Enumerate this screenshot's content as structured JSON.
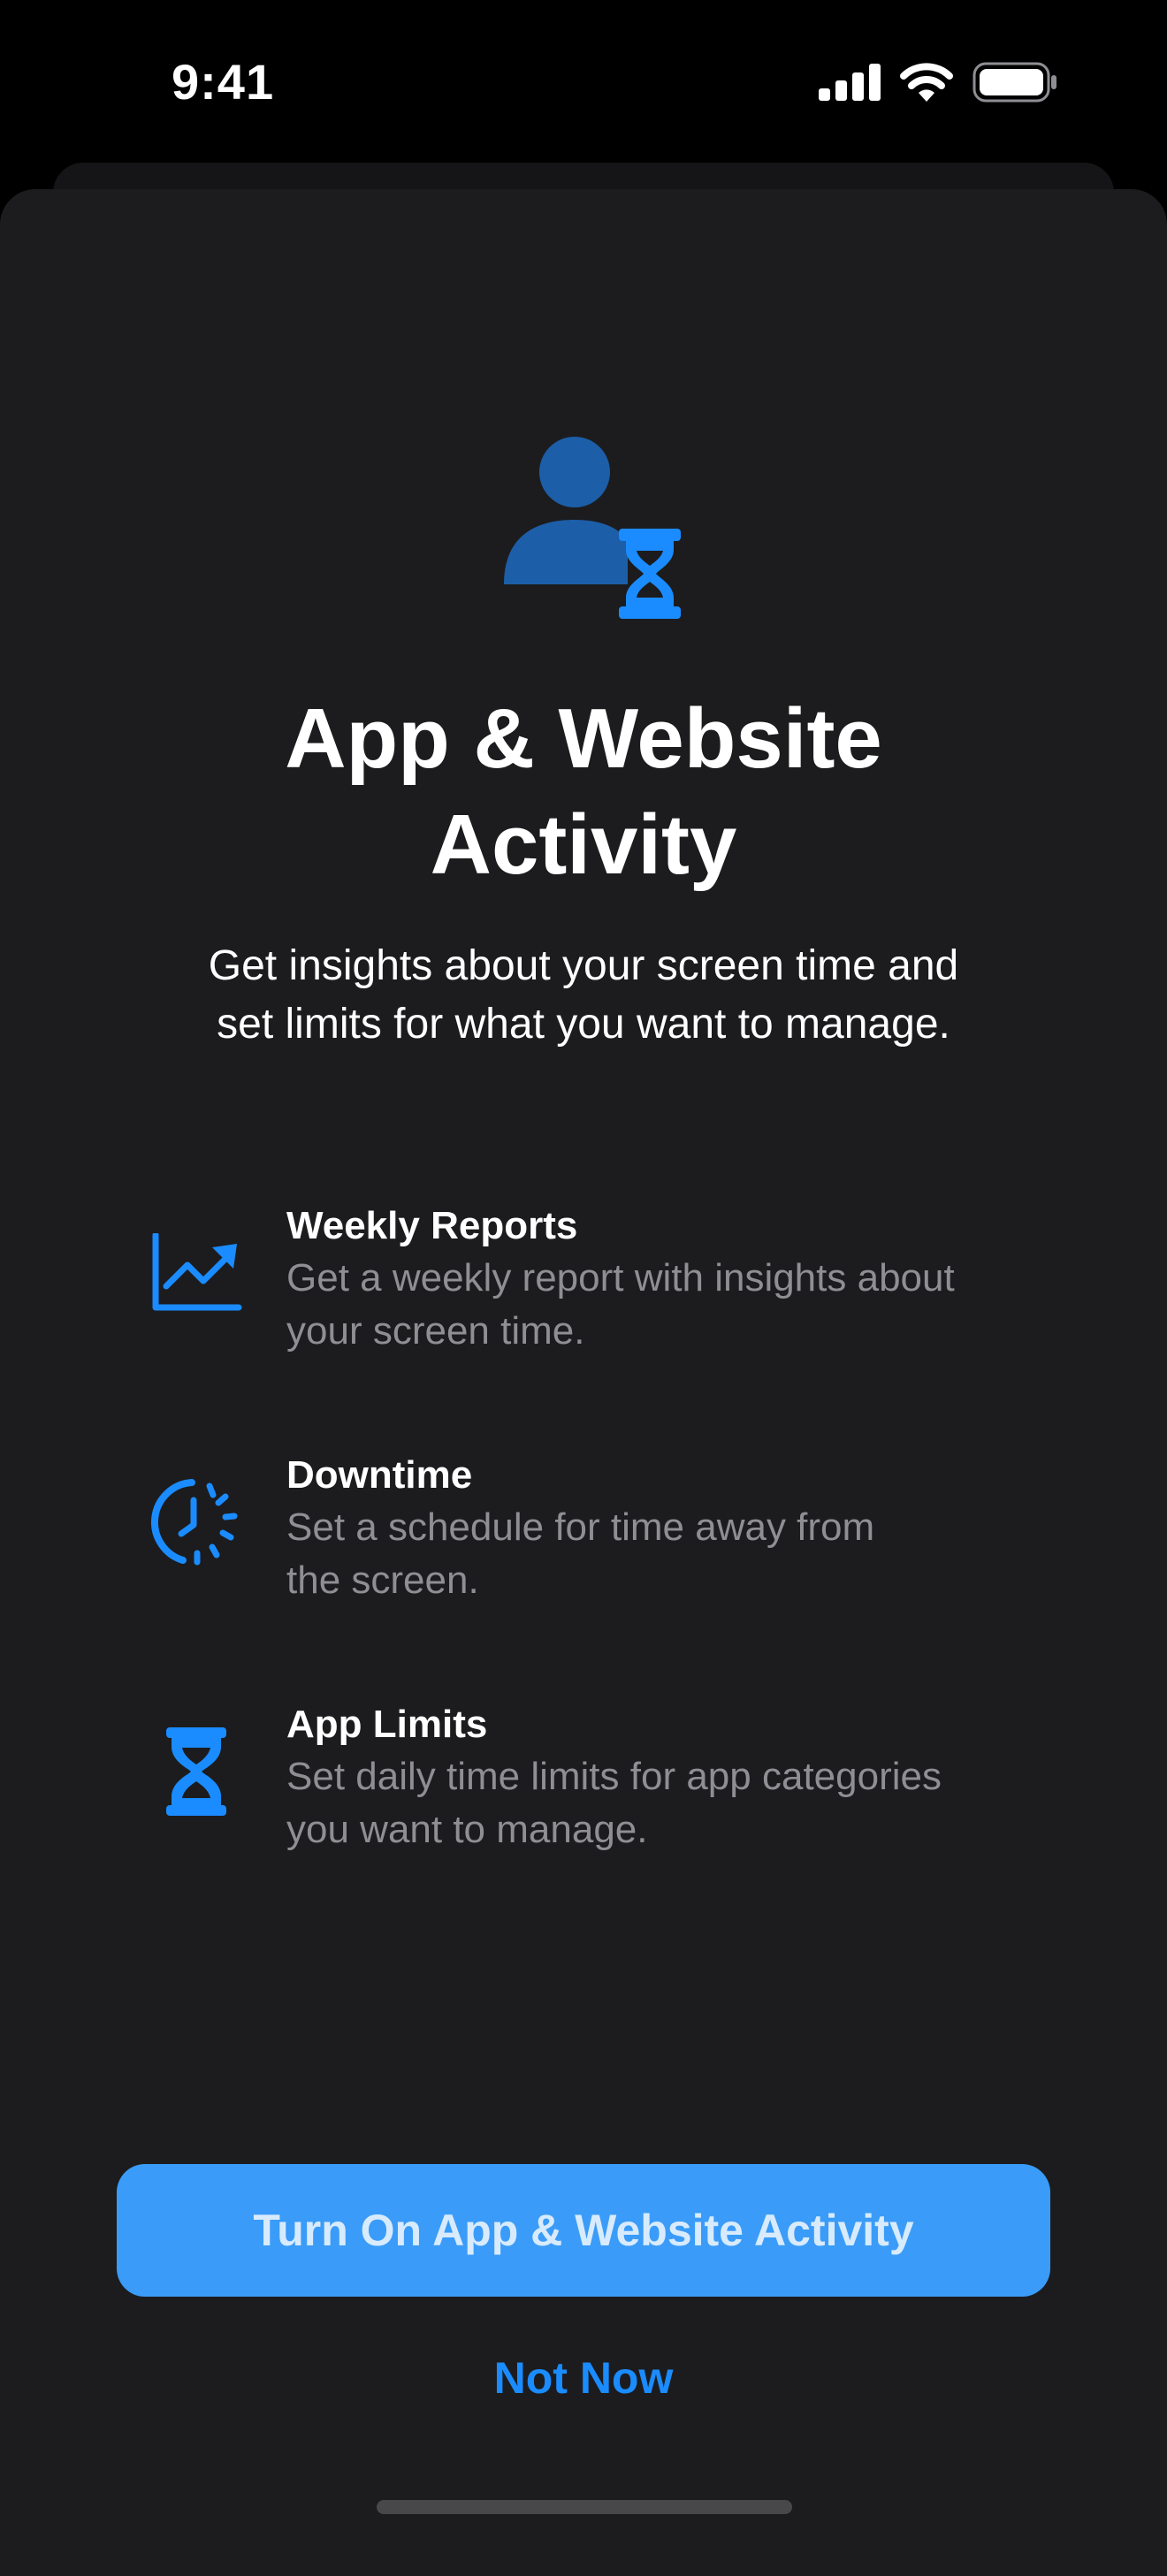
{
  "status_bar": {
    "time": "9:41",
    "icons": [
      "cellular-signal-icon",
      "wifi-icon",
      "battery-icon"
    ]
  },
  "hero": {
    "icon": "person-hourglass-icon",
    "title_line1": "App & Website",
    "title_line2": "Activity",
    "subtitle_line1": "Get insights about your screen time and",
    "subtitle_line2": "set limits for what you want to manage."
  },
  "features": [
    {
      "icon": "chart-line-uptrend-icon",
      "title": "Weekly Reports",
      "desc_line1": "Get a weekly report with insights about",
      "desc_line2": "your screen time."
    },
    {
      "icon": "downtime-clock-icon",
      "title": "Downtime",
      "desc_line1": "Set a schedule for time away from",
      "desc_line2": "the screen."
    },
    {
      "icon": "hourglass-icon",
      "title": "App Limits",
      "desc_line1": "Set daily time limits for app categories",
      "desc_line2": "you want to manage."
    }
  ],
  "actions": {
    "primary_label": "Turn On App & Website Activity",
    "secondary_label": "Not Now"
  },
  "colors": {
    "accent": "#1a8cff",
    "primary_button": "#3a9cf8",
    "sheet_background": "#1c1c1e",
    "secondary_text": "#8e8e93"
  }
}
